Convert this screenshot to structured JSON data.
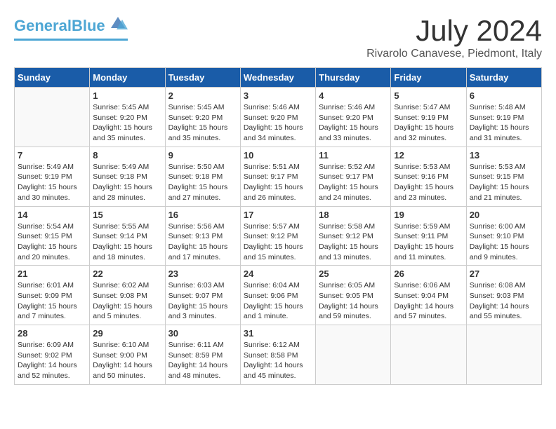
{
  "logo": {
    "part1": "General",
    "part2": "Blue"
  },
  "title": "July 2024",
  "subtitle": "Rivarolo Canavese, Piedmont, Italy",
  "weekdays": [
    "Sunday",
    "Monday",
    "Tuesday",
    "Wednesday",
    "Thursday",
    "Friday",
    "Saturday"
  ],
  "weeks": [
    [
      {
        "day": "",
        "info": ""
      },
      {
        "day": "1",
        "info": "Sunrise: 5:45 AM\nSunset: 9:20 PM\nDaylight: 15 hours\nand 35 minutes."
      },
      {
        "day": "2",
        "info": "Sunrise: 5:45 AM\nSunset: 9:20 PM\nDaylight: 15 hours\nand 35 minutes."
      },
      {
        "day": "3",
        "info": "Sunrise: 5:46 AM\nSunset: 9:20 PM\nDaylight: 15 hours\nand 34 minutes."
      },
      {
        "day": "4",
        "info": "Sunrise: 5:46 AM\nSunset: 9:20 PM\nDaylight: 15 hours\nand 33 minutes."
      },
      {
        "day": "5",
        "info": "Sunrise: 5:47 AM\nSunset: 9:19 PM\nDaylight: 15 hours\nand 32 minutes."
      },
      {
        "day": "6",
        "info": "Sunrise: 5:48 AM\nSunset: 9:19 PM\nDaylight: 15 hours\nand 31 minutes."
      }
    ],
    [
      {
        "day": "7",
        "info": "Sunrise: 5:49 AM\nSunset: 9:19 PM\nDaylight: 15 hours\nand 30 minutes."
      },
      {
        "day": "8",
        "info": "Sunrise: 5:49 AM\nSunset: 9:18 PM\nDaylight: 15 hours\nand 28 minutes."
      },
      {
        "day": "9",
        "info": "Sunrise: 5:50 AM\nSunset: 9:18 PM\nDaylight: 15 hours\nand 27 minutes."
      },
      {
        "day": "10",
        "info": "Sunrise: 5:51 AM\nSunset: 9:17 PM\nDaylight: 15 hours\nand 26 minutes."
      },
      {
        "day": "11",
        "info": "Sunrise: 5:52 AM\nSunset: 9:17 PM\nDaylight: 15 hours\nand 24 minutes."
      },
      {
        "day": "12",
        "info": "Sunrise: 5:53 AM\nSunset: 9:16 PM\nDaylight: 15 hours\nand 23 minutes."
      },
      {
        "day": "13",
        "info": "Sunrise: 5:53 AM\nSunset: 9:15 PM\nDaylight: 15 hours\nand 21 minutes."
      }
    ],
    [
      {
        "day": "14",
        "info": "Sunrise: 5:54 AM\nSunset: 9:15 PM\nDaylight: 15 hours\nand 20 minutes."
      },
      {
        "day": "15",
        "info": "Sunrise: 5:55 AM\nSunset: 9:14 PM\nDaylight: 15 hours\nand 18 minutes."
      },
      {
        "day": "16",
        "info": "Sunrise: 5:56 AM\nSunset: 9:13 PM\nDaylight: 15 hours\nand 17 minutes."
      },
      {
        "day": "17",
        "info": "Sunrise: 5:57 AM\nSunset: 9:12 PM\nDaylight: 15 hours\nand 15 minutes."
      },
      {
        "day": "18",
        "info": "Sunrise: 5:58 AM\nSunset: 9:12 PM\nDaylight: 15 hours\nand 13 minutes."
      },
      {
        "day": "19",
        "info": "Sunrise: 5:59 AM\nSunset: 9:11 PM\nDaylight: 15 hours\nand 11 minutes."
      },
      {
        "day": "20",
        "info": "Sunrise: 6:00 AM\nSunset: 9:10 PM\nDaylight: 15 hours\nand 9 minutes."
      }
    ],
    [
      {
        "day": "21",
        "info": "Sunrise: 6:01 AM\nSunset: 9:09 PM\nDaylight: 15 hours\nand 7 minutes."
      },
      {
        "day": "22",
        "info": "Sunrise: 6:02 AM\nSunset: 9:08 PM\nDaylight: 15 hours\nand 5 minutes."
      },
      {
        "day": "23",
        "info": "Sunrise: 6:03 AM\nSunset: 9:07 PM\nDaylight: 15 hours\nand 3 minutes."
      },
      {
        "day": "24",
        "info": "Sunrise: 6:04 AM\nSunset: 9:06 PM\nDaylight: 15 hours\nand 1 minute."
      },
      {
        "day": "25",
        "info": "Sunrise: 6:05 AM\nSunset: 9:05 PM\nDaylight: 14 hours\nand 59 minutes."
      },
      {
        "day": "26",
        "info": "Sunrise: 6:06 AM\nSunset: 9:04 PM\nDaylight: 14 hours\nand 57 minutes."
      },
      {
        "day": "27",
        "info": "Sunrise: 6:08 AM\nSunset: 9:03 PM\nDaylight: 14 hours\nand 55 minutes."
      }
    ],
    [
      {
        "day": "28",
        "info": "Sunrise: 6:09 AM\nSunset: 9:02 PM\nDaylight: 14 hours\nand 52 minutes."
      },
      {
        "day": "29",
        "info": "Sunrise: 6:10 AM\nSunset: 9:00 PM\nDaylight: 14 hours\nand 50 minutes."
      },
      {
        "day": "30",
        "info": "Sunrise: 6:11 AM\nSunset: 8:59 PM\nDaylight: 14 hours\nand 48 minutes."
      },
      {
        "day": "31",
        "info": "Sunrise: 6:12 AM\nSunset: 8:58 PM\nDaylight: 14 hours\nand 45 minutes."
      },
      {
        "day": "",
        "info": ""
      },
      {
        "day": "",
        "info": ""
      },
      {
        "day": "",
        "info": ""
      }
    ]
  ]
}
